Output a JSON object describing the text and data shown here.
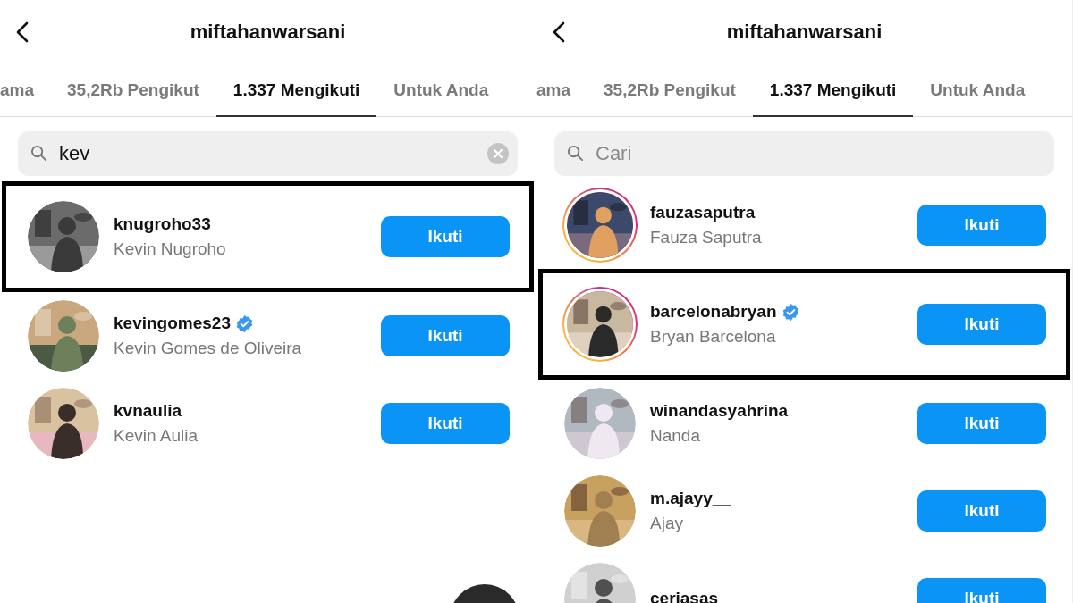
{
  "panels": [
    {
      "title": "miftahanwarsani",
      "tabs": [
        {
          "label": "ama",
          "selected": false
        },
        {
          "label": "35,2Rb Pengikut",
          "selected": false
        },
        {
          "label": "1.337 Mengikuti",
          "selected": true
        },
        {
          "label": "Untuk Anda",
          "selected": false
        }
      ],
      "search": {
        "value": "kev"
      },
      "accounts": [
        {
          "username": "knugroho33",
          "name": "Kevin Nugroho",
          "verified": false,
          "story": false,
          "highlighted": true,
          "button": "Ikuti"
        },
        {
          "username": "kevingomes23",
          "name": "Kevin Gomes de Oliveira",
          "verified": true,
          "story": false,
          "highlighted": false,
          "button": "Ikuti"
        },
        {
          "username": "kvnaulia",
          "name": "Kevin Aulia",
          "verified": false,
          "story": false,
          "highlighted": false,
          "button": "Ikuti"
        }
      ]
    },
    {
      "title": "miftahanwarsani",
      "tabs": [
        {
          "label": "ama",
          "selected": false
        },
        {
          "label": "35,2Rb Pengikut",
          "selected": false
        },
        {
          "label": "1.337 Mengikuti",
          "selected": true
        },
        {
          "label": "Untuk Anda",
          "selected": false
        }
      ],
      "search": {
        "placeholder": "Cari"
      },
      "accounts": [
        {
          "username": "fauzasaputra",
          "name": "Fauza Saputra",
          "verified": false,
          "story": true,
          "highlighted": false,
          "button": "Ikuti"
        },
        {
          "username": "barcelonabryan",
          "name": "Bryan Barcelona",
          "verified": true,
          "story": true,
          "highlighted": true,
          "button": "Ikuti"
        },
        {
          "username": "winandasyahrina",
          "name": "Nanda",
          "verified": false,
          "story": false,
          "highlighted": false,
          "button": "Ikuti"
        },
        {
          "username": "m.ajayy__",
          "name": "Ajay",
          "verified": false,
          "story": false,
          "highlighted": false,
          "button": "Ikuti"
        },
        {
          "username": "ceriasas",
          "verified": false,
          "story": false,
          "highlighted": false,
          "button": "Ikuti"
        }
      ]
    }
  ]
}
